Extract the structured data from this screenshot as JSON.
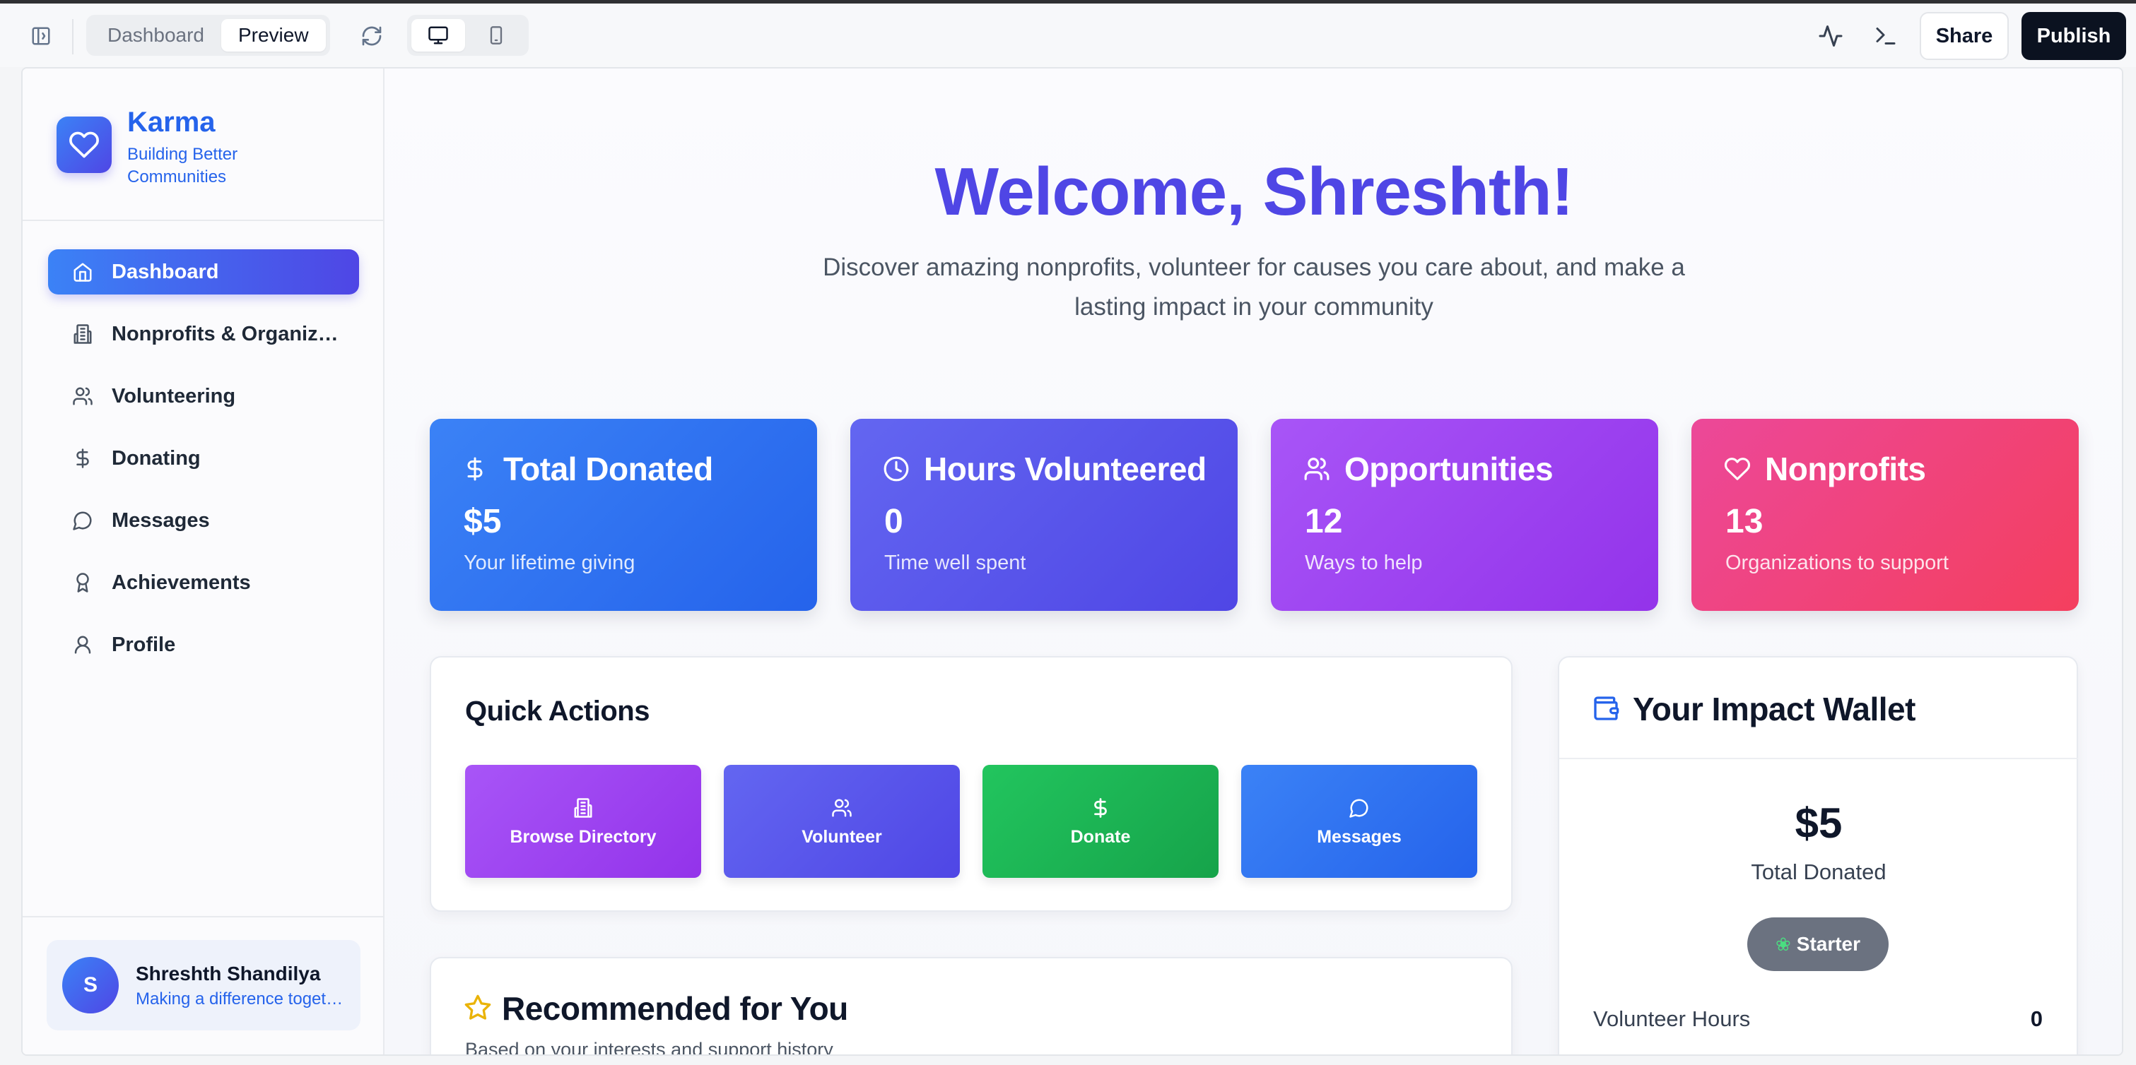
{
  "toolbar": {
    "tabs": [
      "Dashboard",
      "Preview"
    ],
    "active_tab": "Preview",
    "share_label": "Share",
    "publish_label": "Publish",
    "icons": [
      "sidebar-toggle-icon",
      "refresh-icon",
      "desktop-icon",
      "mobile-icon",
      "activity-icon",
      "terminal-icon"
    ]
  },
  "sidebar": {
    "brand_name": "Karma",
    "brand_tagline": "Building Better Communities",
    "items": [
      {
        "label": "Dashboard",
        "icon": "home-icon",
        "active": true
      },
      {
        "label": "Nonprofits & Organizations",
        "icon": "building-icon",
        "active": false
      },
      {
        "label": "Volunteering",
        "icon": "users-icon",
        "active": false
      },
      {
        "label": "Donating",
        "icon": "dollar-icon",
        "active": false
      },
      {
        "label": "Messages",
        "icon": "message-icon",
        "active": false
      },
      {
        "label": "Achievements",
        "icon": "award-icon",
        "active": false
      },
      {
        "label": "Profile",
        "icon": "user-icon",
        "active": false
      }
    ],
    "user": {
      "initial": "S",
      "name": "Shreshth Shandilya",
      "subtitle": "Making a difference together"
    }
  },
  "main": {
    "welcome": "Welcome, Shreshth!",
    "subtitle": "Discover amazing nonprofits, volunteer for causes you care about, and make a lasting impact in your community",
    "stats": [
      {
        "title": "Total Donated",
        "value": "$5",
        "subtitle": "Your lifetime giving",
        "icon": "dollar-icon",
        "color": "#3b82f6"
      },
      {
        "title": "Hours Volunteered",
        "value": "0",
        "subtitle": "Time well spent",
        "icon": "clock-icon",
        "color": "#5b5ce6"
      },
      {
        "title": "Opportunities",
        "value": "12",
        "subtitle": "Ways to help",
        "icon": "users-icon",
        "color": "#a33cf0"
      },
      {
        "title": "Nonprofits",
        "value": "13",
        "subtitle": "Organizations to support",
        "icon": "heart-icon",
        "color": "#ef4170"
      }
    ],
    "quick_actions": {
      "title": "Quick Actions",
      "buttons": [
        {
          "label": "Browse Directory",
          "icon": "building-icon",
          "color": "#a43ded"
        },
        {
          "label": "Volunteer",
          "icon": "users-icon",
          "color": "#5553e6"
        },
        {
          "label": "Donate",
          "icon": "dollar-icon",
          "color": "#1fb358"
        },
        {
          "label": "Messages",
          "icon": "message-icon",
          "color": "#3477ec"
        }
      ]
    },
    "recommended": {
      "title": "Recommended for You",
      "subtitle": "Based on your interests and support history"
    },
    "wallet": {
      "title": "Your Impact Wallet",
      "amount": "$5",
      "amount_label": "Total Donated",
      "tier": "Starter",
      "volunteer_label": "Volunteer Hours",
      "volunteer_value": "0"
    }
  }
}
